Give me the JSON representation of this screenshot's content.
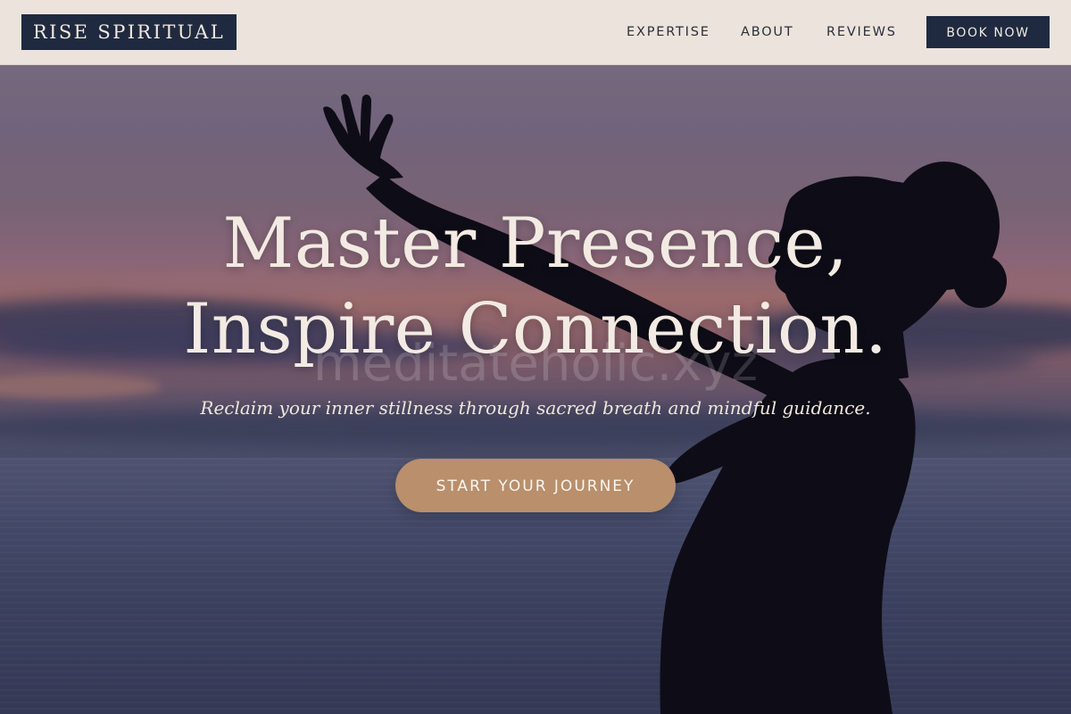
{
  "header": {
    "logo": "RISE SPIRITUAL",
    "nav": {
      "expertise": "EXPERTISE",
      "about": "ABOUT",
      "reviews": "REVIEWS"
    },
    "book_label": "BOOK NOW"
  },
  "hero": {
    "title_line1": "Master Presence,",
    "title_line2": "Inspire Connection.",
    "subtitle": "Reclaim your inner stillness through sacred breath and mindful guidance.",
    "cta_label": "START YOUR JOURNEY",
    "watermark": "meditateholic.xyz"
  },
  "colors": {
    "navy": "#1f2a40",
    "header_bg": "#ebe3dc",
    "cta": "#b98f6c",
    "cream_text": "#f3ebe3"
  }
}
